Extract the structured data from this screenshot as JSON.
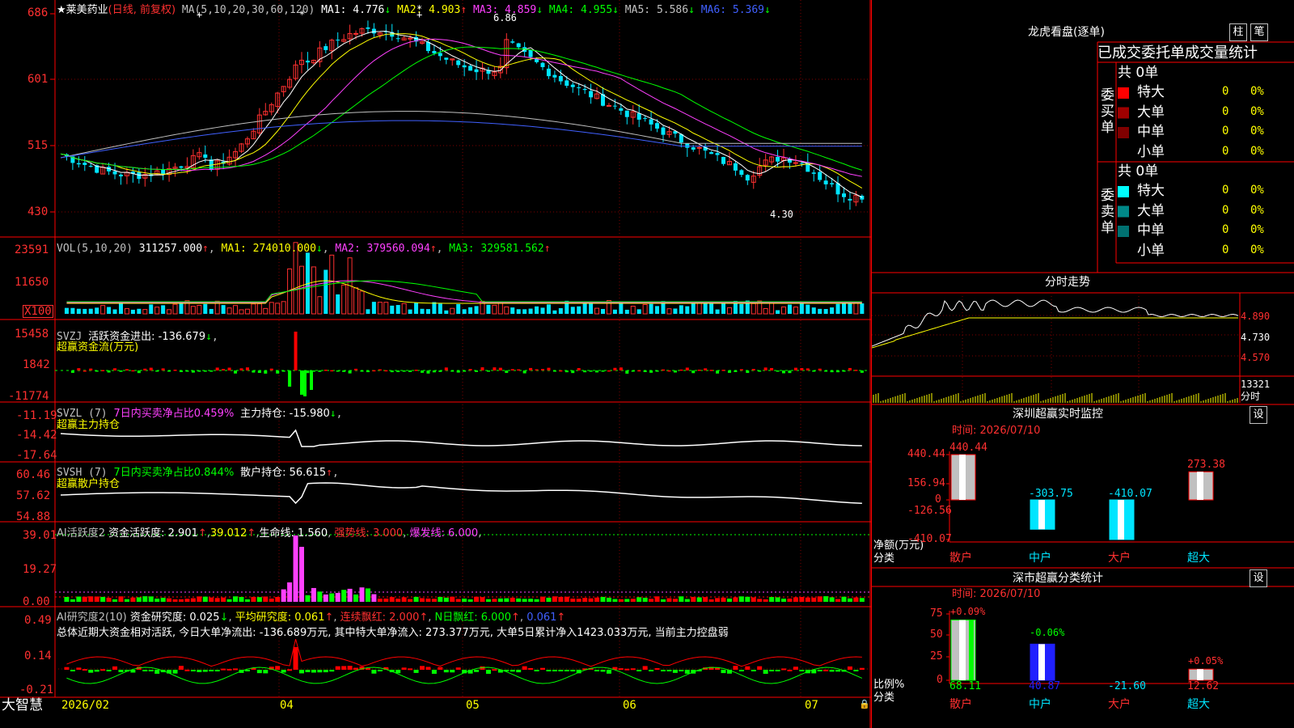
{
  "kline": {
    "title": "★莱美药业",
    "period": "(日线, 前复权)",
    "ma_head": "MA(5,10,20,30,60,120)",
    "ma": [
      {
        "label": "MA1:",
        "value": "4.776",
        "arrow": "↓",
        "color": "#ffffff"
      },
      {
        "label": "MA2:",
        "value": "4.903",
        "arrow": "↑",
        "color": "#ffff00"
      },
      {
        "label": "MA3:",
        "value": "4.859",
        "arrow": "↓",
        "color": "#ff40ff"
      },
      {
        "label": "MA4:",
        "value": "4.955",
        "arrow": "↓",
        "color": "#00ff00"
      },
      {
        "label": "MA5:",
        "value": "5.586",
        "arrow": "↓",
        "color": "#c0c0c0"
      },
      {
        "label": "MA6:",
        "value": "5.369",
        "arrow": "↓",
        "color": "#4060ff"
      }
    ],
    "y_ticks": [
      "686",
      "601",
      "515",
      "430"
    ],
    "high_mark": "6.86",
    "low_mark": "4.30",
    "star_marks": [
      "+",
      "*",
      "*",
      "+"
    ]
  },
  "vol": {
    "head": "VOL(5,10,20)",
    "value": "311257.000",
    "ma1": "MA1: 274010.000",
    "ma2": "MA2: 379560.094",
    "ma3": "MA3: 329581.562",
    "y_ticks": [
      "23591",
      "11650",
      "X100"
    ]
  },
  "svzj": {
    "name": "SVZJ",
    "label": "活跃资金进出: -136.679",
    "sub": "超赢资金流(万元)",
    "y_ticks": [
      "15458",
      "1842",
      "-11774"
    ]
  },
  "svzl": {
    "name": "SVZL (7)",
    "pct": "7日内买卖净占比0.459%",
    "label": "主力持仓: -15.980",
    "sub": "超赢主力持仓",
    "y_ticks": [
      "-11.19",
      "-14.42",
      "-17.64"
    ]
  },
  "svsh": {
    "name": "SVSH (7)",
    "pct": "7日内买卖净占比0.844%",
    "label": "散户持仓: 56.615",
    "sub": "超赢散户持仓",
    "y_ticks": [
      "60.46",
      "57.62",
      "54.88"
    ]
  },
  "ai1": {
    "name": "AI活跃度2",
    "a": "资金活跃度: 2.901",
    "b": "39.012",
    "c": "生命线: 1.560",
    "d": "强势线: 3.000",
    "e": "爆发线: 6.000",
    "y_ticks": [
      "39.01",
      "19.27",
      "0.00"
    ]
  },
  "ai2": {
    "name": "AI研究度2(10)",
    "a": "资金研究度: 0.025",
    "b": "平均研究度: 0.061",
    "c": "连续飘红: 2.000",
    "d": "N日飘红: 6.000",
    "e": "0.061",
    "summary": "总体近期大资金相对活跃, 今日大单净流出: -136.689万元, 其中特大单净流入: 273.377万元, 大单5日累计净入1423.033万元, 当前主力控盘弱",
    "y_ticks": [
      "0.49",
      "0.14",
      "-0.21"
    ]
  },
  "xaxis": {
    "logo": "大智慧",
    "labels": [
      "2026/02",
      "04",
      "05",
      "06",
      "07"
    ]
  },
  "dragon": {
    "title": "龙虎看盘(逐单)",
    "btn1": "柱",
    "btn2": "笔",
    "tabs": "已成交委托单成交量统计",
    "buy_label": "委买单",
    "sell_label": "委卖单",
    "buy_total": "共 0单",
    "sell_total": "共 0单",
    "rows": [
      {
        "name": "特大",
        "count": "0",
        "pct": "0%"
      },
      {
        "name": "大单",
        "count": "0",
        "pct": "0%"
      },
      {
        "name": "中单",
        "count": "0",
        "pct": "0%"
      },
      {
        "name": "小单",
        "count": "0",
        "pct": "0%"
      }
    ],
    "buy_colors": [
      "#ff0000",
      "#a00000",
      "#800000",
      ""
    ],
    "sell_colors": [
      "#00ffff",
      "#008888",
      "#007070",
      ""
    ]
  },
  "intraday": {
    "title": "分时走势",
    "prices": [
      "4.890",
      "4.730",
      "4.570"
    ],
    "vol": "13321",
    "vol2": "分时"
  },
  "monitor": {
    "title": "深圳超赢实时监控",
    "settings": "设",
    "time": "时间: 2026/07/10",
    "y_ticks": [
      "440.44",
      "156.94",
      "0",
      "-126.56",
      "-410.07"
    ],
    "ylabel1": "净额(万元)",
    "ylabel2": "分类",
    "cats": [
      "散户",
      "中户",
      "大户",
      "超大"
    ],
    "values": [
      440.44,
      -303.75,
      -410.07,
      273.38
    ],
    "value_labels": [
      "440.44",
      "-303.75",
      "-410.07",
      "273.38"
    ]
  },
  "classify": {
    "title": "深市超赢分类统计",
    "settings": "设",
    "time": "时间: 2026/07/10",
    "y_ticks": [
      "75",
      "50",
      "25",
      "0"
    ],
    "ylabel1": "比例%",
    "ylabel2": "分类",
    "cats": [
      "散户",
      "中户",
      "大户",
      "超大"
    ],
    "top_labels": [
      "+0.09%",
      "-0.06%",
      "",
      "+0.05%"
    ],
    "bottom_labels": [
      "68.11",
      "40.87",
      "-21.60",
      "12.62"
    ],
    "values": [
      68.11,
      40.87,
      -21.6,
      12.62
    ]
  },
  "chart_data": [
    {
      "type": "bar",
      "title": "深圳超赢实时监控",
      "categories": [
        "散户",
        "中户",
        "大户",
        "超大"
      ],
      "values": [
        440.44,
        -303.75,
        -410.07,
        273.38
      ],
      "xlabel": "分类",
      "ylabel": "净额(万元)",
      "ylim": [
        -410.07,
        440.44
      ]
    },
    {
      "type": "bar",
      "title": "深市超赢分类统计",
      "categories": [
        "散户",
        "中户",
        "大户",
        "超大"
      ],
      "values": [
        68.11,
        40.87,
        -21.6,
        12.62
      ],
      "xlabel": "分类",
      "ylabel": "比例%",
      "ylim": [
        0,
        75
      ]
    }
  ]
}
